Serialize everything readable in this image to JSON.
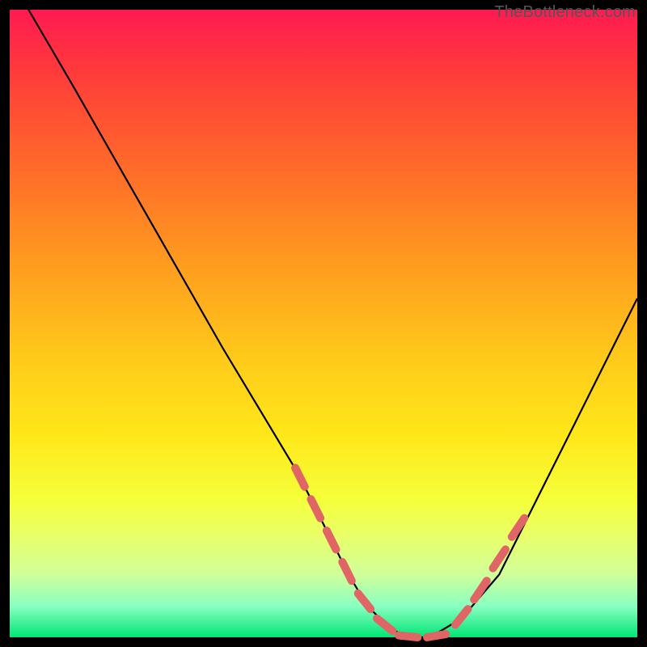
{
  "attribution": "TheBottleneck.com",
  "colors": {
    "frame": "#000000",
    "curve": "#000000",
    "marker": "#e06666",
    "gradient_top": "#ff1a52",
    "gradient_bottom": "#00e676"
  },
  "chart_data": {
    "type": "line",
    "title": "",
    "xlabel": "",
    "ylabel": "",
    "xlim": [
      0,
      100
    ],
    "ylim": [
      0,
      100
    ],
    "grid": false,
    "legend": false,
    "annotations": [],
    "series": [
      {
        "name": "curve",
        "x": [
          3,
          10,
          18,
          26,
          34,
          40,
          46,
          50,
          54,
          57,
          60,
          63,
          67,
          72,
          78,
          84,
          90,
          96,
          100
        ],
        "y": [
          100,
          88,
          74,
          60,
          46,
          36,
          26,
          18,
          10,
          5,
          2,
          0,
          0,
          3,
          10,
          22,
          34,
          46,
          54
        ]
      }
    ],
    "markers": [
      {
        "name": "highlight-dashes-left",
        "segments": [
          {
            "x1": 45.5,
            "y1": 27.0,
            "x2": 47.0,
            "y2": 24.0
          },
          {
            "x1": 48.0,
            "y1": 22.0,
            "x2": 49.5,
            "y2": 19.0
          },
          {
            "x1": 50.5,
            "y1": 17.0,
            "x2": 52.0,
            "y2": 14.0
          },
          {
            "x1": 53.0,
            "y1": 12.0,
            "x2": 54.5,
            "y2": 9.0
          },
          {
            "x1": 55.5,
            "y1": 7.0,
            "x2": 57.5,
            "y2": 4.5
          },
          {
            "x1": 58.5,
            "y1": 3.0,
            "x2": 61.0,
            "y2": 1.0
          }
        ]
      },
      {
        "name": "highlight-dashes-bottom",
        "segments": [
          {
            "x1": 62.0,
            "y1": 0.3,
            "x2": 65.0,
            "y2": 0.0
          },
          {
            "x1": 66.5,
            "y1": 0.0,
            "x2": 69.5,
            "y2": 0.5
          }
        ]
      },
      {
        "name": "highlight-dashes-right",
        "segments": [
          {
            "x1": 71.0,
            "y1": 2.0,
            "x2": 73.0,
            "y2": 4.5
          },
          {
            "x1": 74.0,
            "y1": 6.0,
            "x2": 76.0,
            "y2": 9.0
          },
          {
            "x1": 77.0,
            "y1": 11.0,
            "x2": 79.0,
            "y2": 14.0
          },
          {
            "x1": 80.0,
            "y1": 16.0,
            "x2": 82.0,
            "y2": 19.0
          }
        ]
      }
    ]
  }
}
